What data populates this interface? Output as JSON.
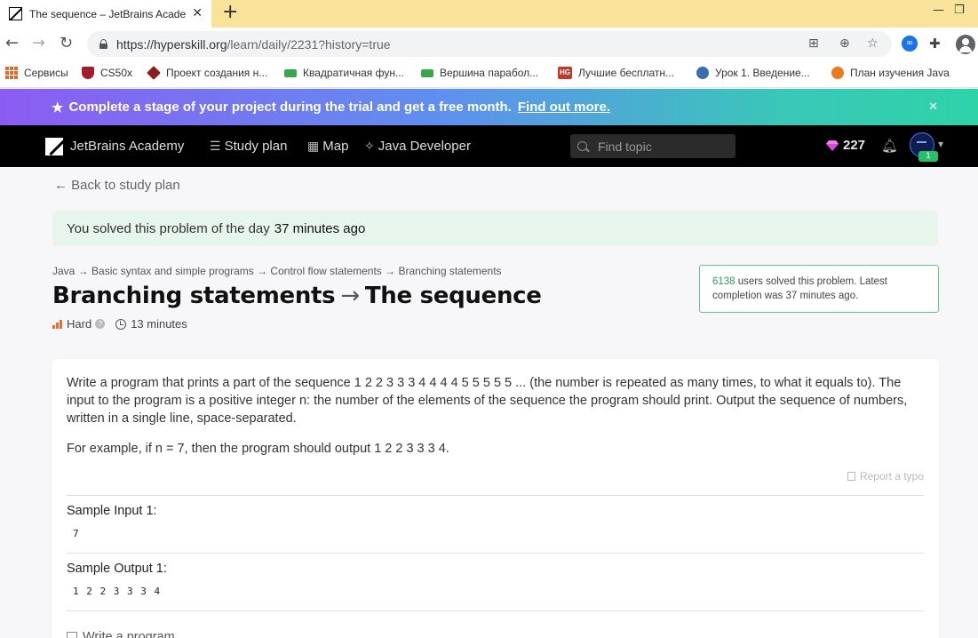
{
  "browser": {
    "tab_title": "The sequence – JetBrains Academy",
    "url_host": "https://hyperskill.org",
    "url_path": "/learn/daily/2231?history=true",
    "bookmarks": [
      {
        "label": "Сервисы",
        "color": "#e06a2a"
      },
      {
        "label": "CS50x",
        "color": "#a51c30"
      },
      {
        "label": "Проект создания н...",
        "color": "#c0392b"
      },
      {
        "label": "Квадратичная фун...",
        "color": "#3aa64a"
      },
      {
        "label": "Вершина парабол...",
        "color": "#3aa64a"
      },
      {
        "label": "Лучшие бесплатн...",
        "color": "#c0392b"
      },
      {
        "label": "Урок 1. Введение...",
        "color": "#3b6db3"
      },
      {
        "label": "План изучения Java",
        "color": "#ea7b1d"
      }
    ],
    "bookmark_hg_label": "HG"
  },
  "promo": {
    "text": "Complete a stage of your project during the trial and get a free month.",
    "link": "Find out more."
  },
  "nav": {
    "brand": "JetBrains Academy",
    "study_plan": "Study plan",
    "map": "Map",
    "track": "Java Developer",
    "search_placeholder": "Find topic",
    "gems": "227",
    "avatar_badge": "1"
  },
  "content": {
    "back": "← Back to study plan",
    "solved_prefix": "You solved this problem of the day",
    "solved_time": "37 minutes ago",
    "breadcrumbs": "Java → Basic syntax and simple programs → Control flow statements → Branching statements",
    "title_topic": "Branching statements",
    "title_arrow": "→",
    "title_problem": "The sequence",
    "difficulty": "Hard",
    "duration": "13 minutes",
    "stats_count": "6138",
    "stats_text": " users solved this problem. Latest completion was 37 minutes ago.",
    "description": "Write a program that prints a part of the sequence 1 2 2 3 3 3 4 4 4 4 5 5 5 5 5 ... (the number is repeated as many times, to what it equals to). The input to the program is a positive integer n: the number of the elements of the sequence the program should print. Output the sequence of numbers, written in a single line, space-separated.",
    "example": "For example, if n = 7, then the program should output 1 2 2 3 3 3 4.",
    "report": "Report a typo",
    "sample_input_label": "Sample Input 1:",
    "sample_input": "7",
    "sample_output_label": "Sample Output 1:",
    "sample_output": "1 2 2 3 3 3 4",
    "write_program": "Write a program"
  }
}
